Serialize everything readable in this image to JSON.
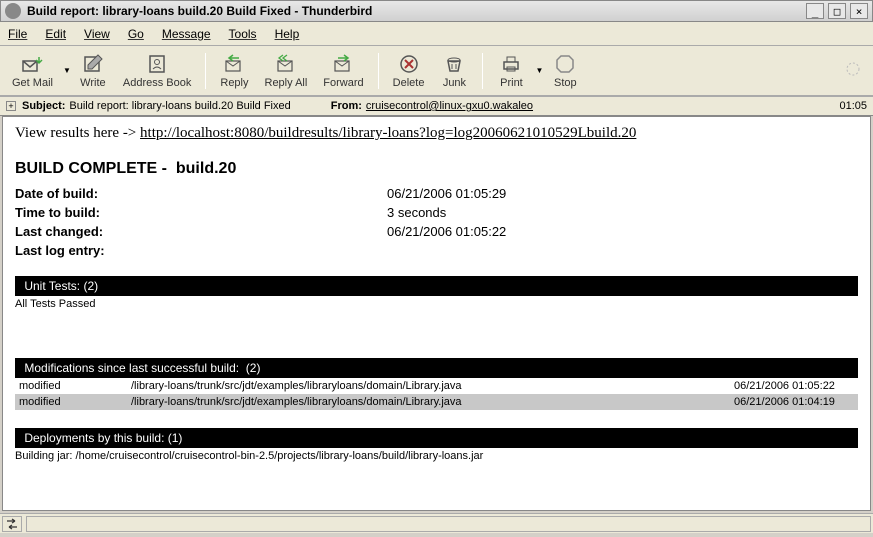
{
  "window": {
    "title": "Build report: library-loans build.20 Build Fixed - Thunderbird"
  },
  "menu": {
    "file": "File",
    "edit": "Edit",
    "view": "View",
    "go": "Go",
    "message": "Message",
    "tools": "Tools",
    "help": "Help"
  },
  "toolbar": {
    "getmail": "Get Mail",
    "write": "Write",
    "addressbook": "Address Book",
    "reply": "Reply",
    "replyall": "Reply All",
    "forward": "Forward",
    "delete": "Delete",
    "junk": "Junk",
    "print": "Print",
    "stop": "Stop"
  },
  "header": {
    "subject_label": "Subject:",
    "subject": "Build report: library-loans build.20 Build Fixed",
    "from_label": "From:",
    "from": "cruisecontrol@linux-gxu0.wakaleo",
    "time": "01:05"
  },
  "body": {
    "view_results_prefix": "View results here -> ",
    "view_results_url": "http://localhost:8080/buildresults/library-loans?log=log20060621010529Lbuild.20",
    "build_complete": "BUILD COMPLETE -  build.20",
    "info": [
      {
        "k": "Date of build:",
        "v": "06/21/2006 01:05:29"
      },
      {
        "k": "Time to build:",
        "v": "3 seconds"
      },
      {
        "k": "Last changed:",
        "v": "06/21/2006 01:05:22"
      },
      {
        "k": "Last log entry:",
        "v": ""
      }
    ],
    "unit_tests": {
      "header_label": "Unit Tests:",
      "header_count": "(2)",
      "text": "All Tests Passed"
    },
    "modifications": {
      "header_label": "Modifications since last successful build:",
      "header_count": "(2)",
      "rows": [
        {
          "status": "modified",
          "path": "/library-loans/trunk/src/jdt/examples/libraryloans/domain/Library.java",
          "date": "06/21/2006 01:05:22"
        },
        {
          "status": "modified",
          "path": "/library-loans/trunk/src/jdt/examples/libraryloans/domain/Library.java",
          "date": "06/21/2006 01:04:19"
        }
      ]
    },
    "deployments": {
      "header_label": "Deployments by this build:",
      "header_count": "(1)",
      "text": "Building jar: /home/cruisecontrol/cruisecontrol-bin-2.5/projects/library-loans/build/library-loans.jar"
    }
  }
}
